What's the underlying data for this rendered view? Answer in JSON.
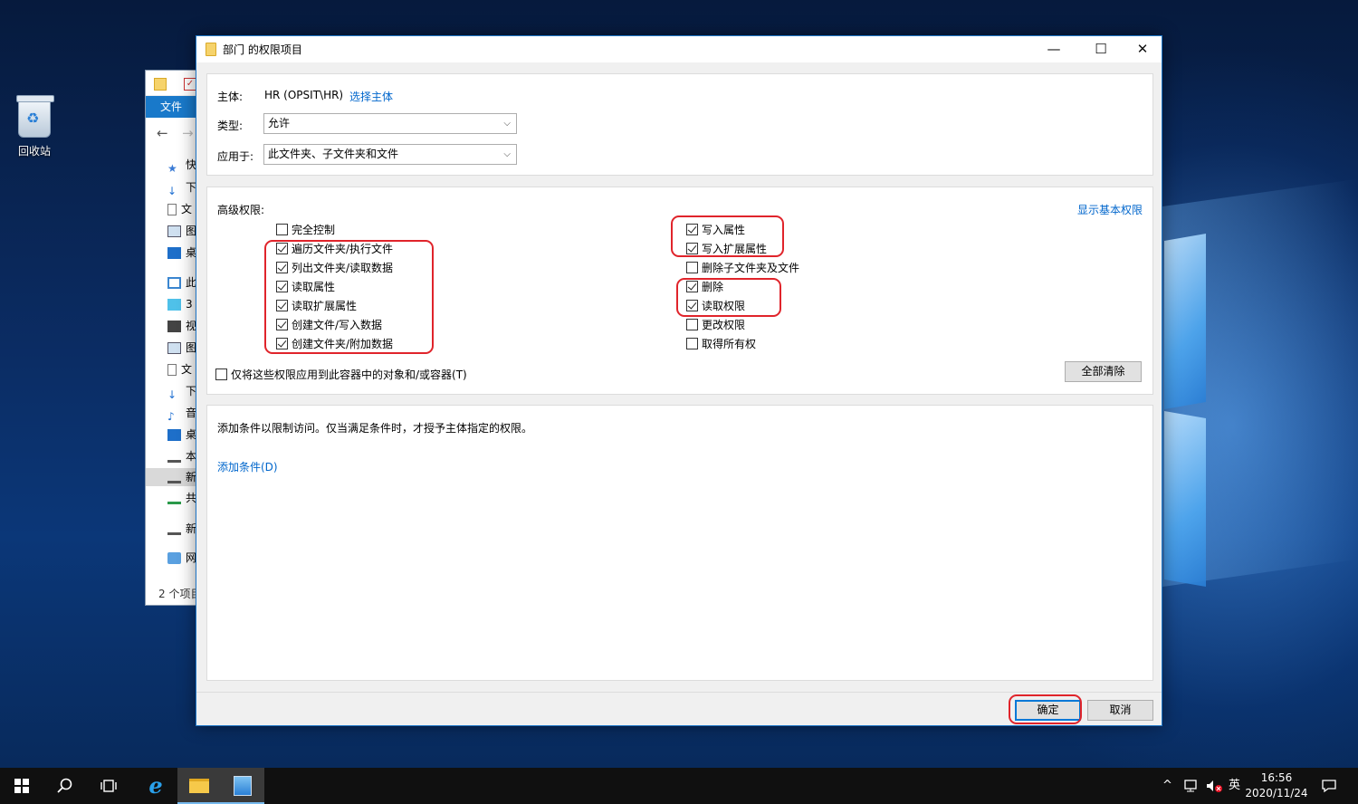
{
  "desktop": {
    "recycle_bin_label": "回收站"
  },
  "explorer": {
    "ribbon_tab": "文件",
    "nav_back": "←",
    "nav_forward": "→",
    "tree": [
      {
        "label": "快",
        "icon": "star-icon"
      },
      {
        "label": "下",
        "icon": "download-icon"
      },
      {
        "label": "文",
        "icon": "document-icon"
      },
      {
        "label": "图",
        "icon": "picture-icon"
      },
      {
        "label": "桌",
        "icon": "desktop-icon"
      },
      {
        "label": "此",
        "icon": "computer-icon"
      },
      {
        "label": "3",
        "icon": "cube-icon"
      },
      {
        "label": "视",
        "icon": "video-icon"
      },
      {
        "label": "图",
        "icon": "picture-icon"
      },
      {
        "label": "文",
        "icon": "document-icon"
      },
      {
        "label": "下",
        "icon": "download-icon"
      },
      {
        "label": "音",
        "icon": "music-icon"
      },
      {
        "label": "桌",
        "icon": "desktop-icon"
      },
      {
        "label": "本",
        "icon": "drive-icon"
      },
      {
        "label": "新",
        "icon": "drive-icon"
      },
      {
        "label": "共",
        "icon": "network-drive-icon"
      },
      {
        "label": "新",
        "icon": "drive-icon"
      },
      {
        "label": "网",
        "icon": "network-icon"
      }
    ],
    "status": "2 个项目"
  },
  "dialog": {
    "title": "部门 的权限项目",
    "window_controls": {
      "minimize": "—",
      "maximize": "☐",
      "close": "✕"
    },
    "principal_label": "主体:",
    "principal_value": "HR (OPSIT\\HR)",
    "select_principal_link": "选择主体",
    "type_label": "类型:",
    "type_value": "允许",
    "applies_label": "应用于:",
    "applies_value": "此文件夹、子文件夹和文件",
    "advanced_label": "高级权限:",
    "show_basic_link": "显示基本权限",
    "permissions_left": [
      {
        "label": "完全控制",
        "checked": false
      },
      {
        "label": "遍历文件夹/执行文件",
        "checked": true
      },
      {
        "label": "列出文件夹/读取数据",
        "checked": true
      },
      {
        "label": "读取属性",
        "checked": true
      },
      {
        "label": "读取扩展属性",
        "checked": true
      },
      {
        "label": "创建文件/写入数据",
        "checked": true
      },
      {
        "label": "创建文件夹/附加数据",
        "checked": true
      }
    ],
    "permissions_right": [
      {
        "label": "写入属性",
        "checked": true
      },
      {
        "label": "写入扩展属性",
        "checked": true
      },
      {
        "label": "删除子文件夹及文件",
        "checked": false
      },
      {
        "label": "删除",
        "checked": true
      },
      {
        "label": "读取权限",
        "checked": true
      },
      {
        "label": "更改权限",
        "checked": false
      },
      {
        "label": "取得所有权",
        "checked": false
      }
    ],
    "apply_only_label": "仅将这些权限应用到此容器中的对象和/或容器(T)",
    "apply_only_checked": false,
    "clear_all_button": "全部清除",
    "condition_text": "添加条件以限制访问。仅当满足条件时，才授予主体指定的权限。",
    "add_condition_link": "添加条件(D)",
    "ok_button": "确定",
    "cancel_button": "取消"
  },
  "annotation_color": "#e0242b",
  "taskbar": {
    "tray_ime": "英",
    "time": "16:56",
    "date": "2020/11/24",
    "tray_up_arrow": "^"
  }
}
